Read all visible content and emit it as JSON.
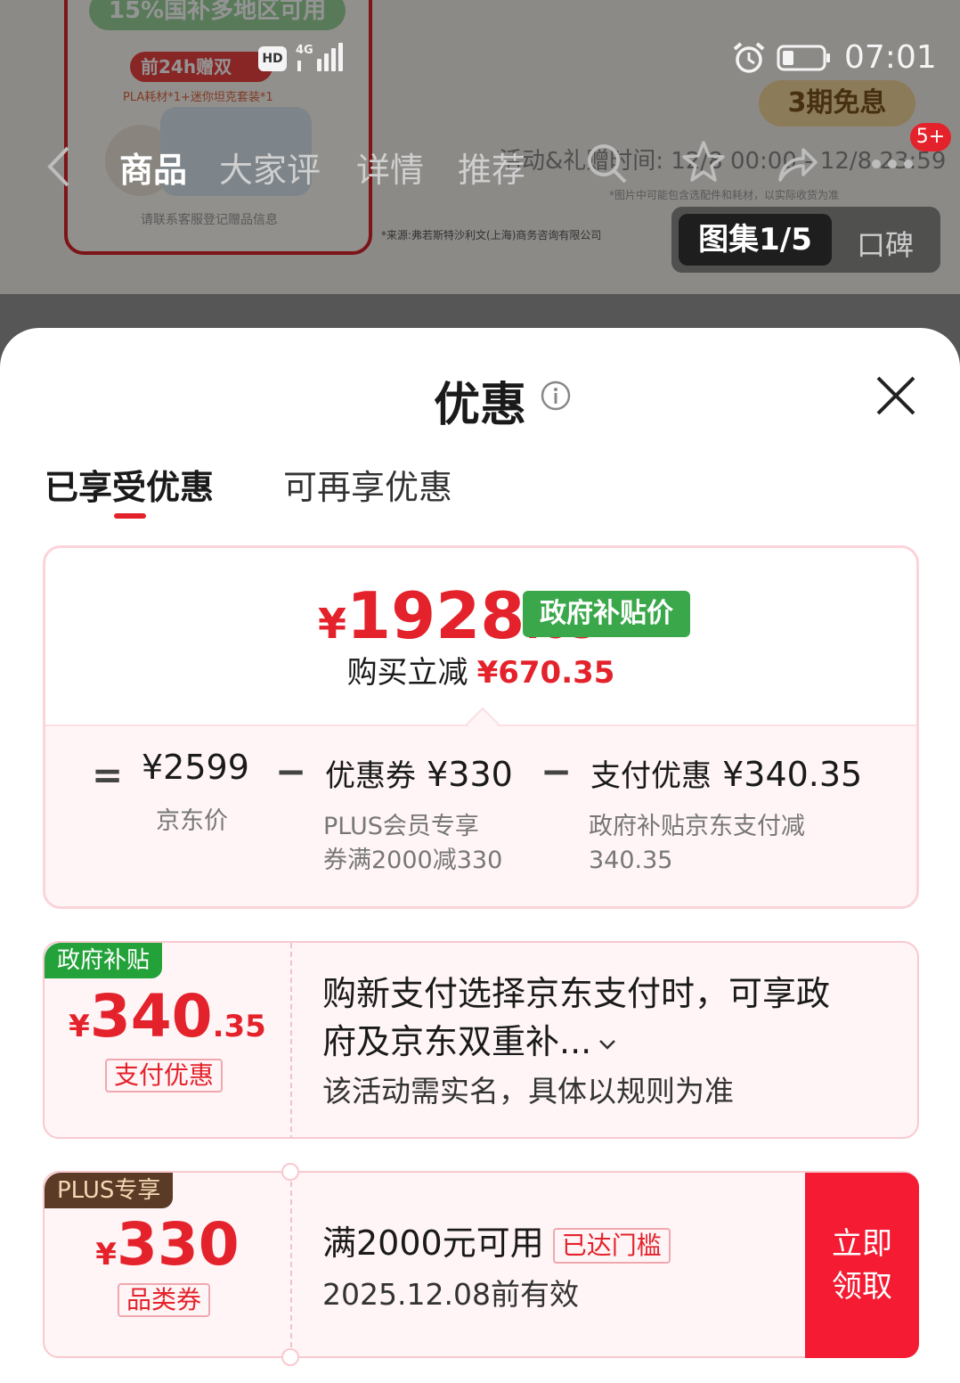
{
  "background": {
    "promo_banner": "15%国补多地区可用",
    "gift_pill": "前24h赠双",
    "gift_detail": "PLA耗材*1+迷你坦克套装*1",
    "contact_note": "请联系客服登记赠品信息",
    "installment_badge": "3期免息",
    "activity_time": "活动&礼赠时间: 12/8 00:00 - 12/8 23:59",
    "image_note": "*图片中可能包含选配件和耗材，以实际收货为准",
    "source_note": "*来源:弗若斯特沙利文(上海)商务咨询有限公司",
    "gallery": {
      "active_label": "图集1/5",
      "other_label": "口碑"
    }
  },
  "statusbar": {
    "time": "07:01",
    "hd": "HD"
  },
  "nav": {
    "tabs": [
      "商品",
      "大家评",
      "详情",
      "推荐"
    ],
    "badge": "5+"
  },
  "sheet": {
    "title": "优惠",
    "tabs": {
      "active": "已享受优惠",
      "inactive": "可再享优惠"
    }
  },
  "summary": {
    "final_price": {
      "currency": "¥",
      "integer": "1928",
      "decimal": ".65"
    },
    "price_tag": "政府补贴价",
    "reduce_label": "购买立减",
    "reduce_amount": "¥670.35",
    "equals": "=",
    "minus": "−",
    "jd_price": "¥2599",
    "jd_price_label": "京东价",
    "coupon_label": "优惠券",
    "coupon_amount": "¥330",
    "coupon_desc_1": "PLUS会员专享",
    "coupon_desc_2": "券满2000减330",
    "pay_label": "支付优惠",
    "pay_amount": "¥340.35",
    "pay_desc_1": "政府补贴京东支付减",
    "pay_desc_2": "340.35"
  },
  "cards": [
    {
      "tag": "政府补贴",
      "amount": {
        "currency": "¥",
        "integer": "340",
        "decimal": ".35"
      },
      "type": "支付优惠",
      "title_1": "购新支付选择京东支付时，可享政",
      "title_2": "府及京东双重补...",
      "subtitle": "该活动需实名，具体以规则为准"
    },
    {
      "tag": "PLUS专享",
      "amount": {
        "currency": "¥",
        "integer": "330"
      },
      "type": "品类券",
      "title": "满2000元可用",
      "threshold": "已达门槛",
      "subtitle": "2025.12.08前有效",
      "button_1": "立即",
      "button_2": "领取"
    }
  ],
  "colors": {
    "accent": "#e4222b",
    "gov_green": "#3aa84a",
    "plus_brown": "#5b3a26"
  }
}
